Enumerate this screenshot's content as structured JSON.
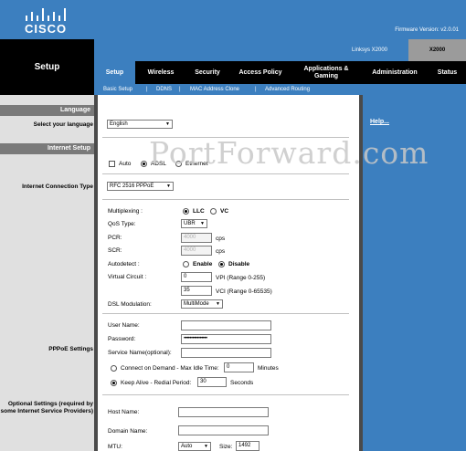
{
  "header": {
    "brand": "CISCO",
    "firmware": "Firmware Version: v2.0.01",
    "model_name": "Linksys X2000",
    "model_code": "X2000"
  },
  "page": {
    "title": "Setup"
  },
  "nav": {
    "setup": "Setup",
    "wireless": "Wireless",
    "security": "Security",
    "access": "Access Policy",
    "apps": "Applications & Gaming",
    "admin": "Administration",
    "status": "Status"
  },
  "subnav": {
    "basic": "Basic Setup",
    "ddns": "DDNS",
    "mac": "MAC Address Clone",
    "advanced": "Advanced Routing",
    "sep": "|"
  },
  "sections": {
    "language": "Language",
    "select_language": "Select your language",
    "internet_setup": "Internet Setup",
    "connection_type": "Internet Connection Type",
    "pppoe_settings": "PPPoE Settings",
    "optional_settings": "Optional Settings (required by some Internet Service Providers)"
  },
  "language": {
    "value": "English"
  },
  "mode": {
    "auto": "Auto",
    "adsl": "ADSL",
    "ethernet": "Ethernet"
  },
  "connection": {
    "type": "RFC 2516 PPPoE"
  },
  "dsl": {
    "multiplexing_label": "Multiplexing :",
    "llc": "LLC",
    "vc": "VC",
    "qos_label": "QoS Type:",
    "qos_value": "UBR",
    "pcr_label": "PCR:",
    "pcr_value": "4000",
    "pcr_unit": "cps",
    "scr_label": "SCR:",
    "scr_value": "4000",
    "scr_unit": "cps",
    "autodetect_label": "Autodetect :",
    "enable": "Enable",
    "disable": "Disable",
    "vc_label": "Virtual Circuit :",
    "vpi_value": "0",
    "vpi_text": "VPI (Range 0-255)",
    "vci_value": "35",
    "vci_text": "VCI (Range 0-65535)",
    "modulation_label": "DSL Modulation:",
    "modulation_value": "MultiMode"
  },
  "pppoe": {
    "username_label": "User Name:",
    "username_value": "",
    "password_label": "Password:",
    "password_value": "••••••••••••••••",
    "service_label": "Service Name(optional):",
    "service_value": "",
    "cod_label": "Connect on Demand - Max Idle Time:",
    "cod_value": "0",
    "cod_unit": "Minutes",
    "keepalive_label": "Keep Alive - Redial Period:",
    "keepalive_value": "30",
    "keepalive_unit": "Seconds"
  },
  "optional": {
    "host_label": "Host Name:",
    "host_value": "",
    "domain_label": "Domain Name:",
    "domain_value": "",
    "mtu_label": "MTU:",
    "mtu_value": "Auto",
    "size_label": "Size:",
    "size_value": "1492"
  },
  "help": {
    "label": "Help..."
  },
  "watermark": "PortForward.com",
  "colors": {
    "blue": "#3c7fbf",
    "black": "#000000",
    "gray": "#7a7a7a"
  }
}
